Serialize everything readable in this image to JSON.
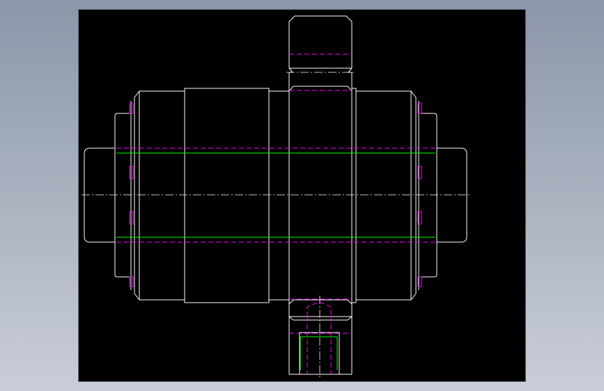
{
  "colors": {
    "background_top": "#8b96a8",
    "background_bottom": "#c9ced8",
    "viewport": "#000000",
    "outline": "#ffffff",
    "hidden_line": "#ff00ff",
    "thread_line": "#00ff00",
    "center_line": "#ffffff"
  },
  "drawing": {
    "view": "front-section",
    "line_types": [
      "continuous",
      "hidden-dashed",
      "center-dash-dot",
      "thread"
    ]
  }
}
